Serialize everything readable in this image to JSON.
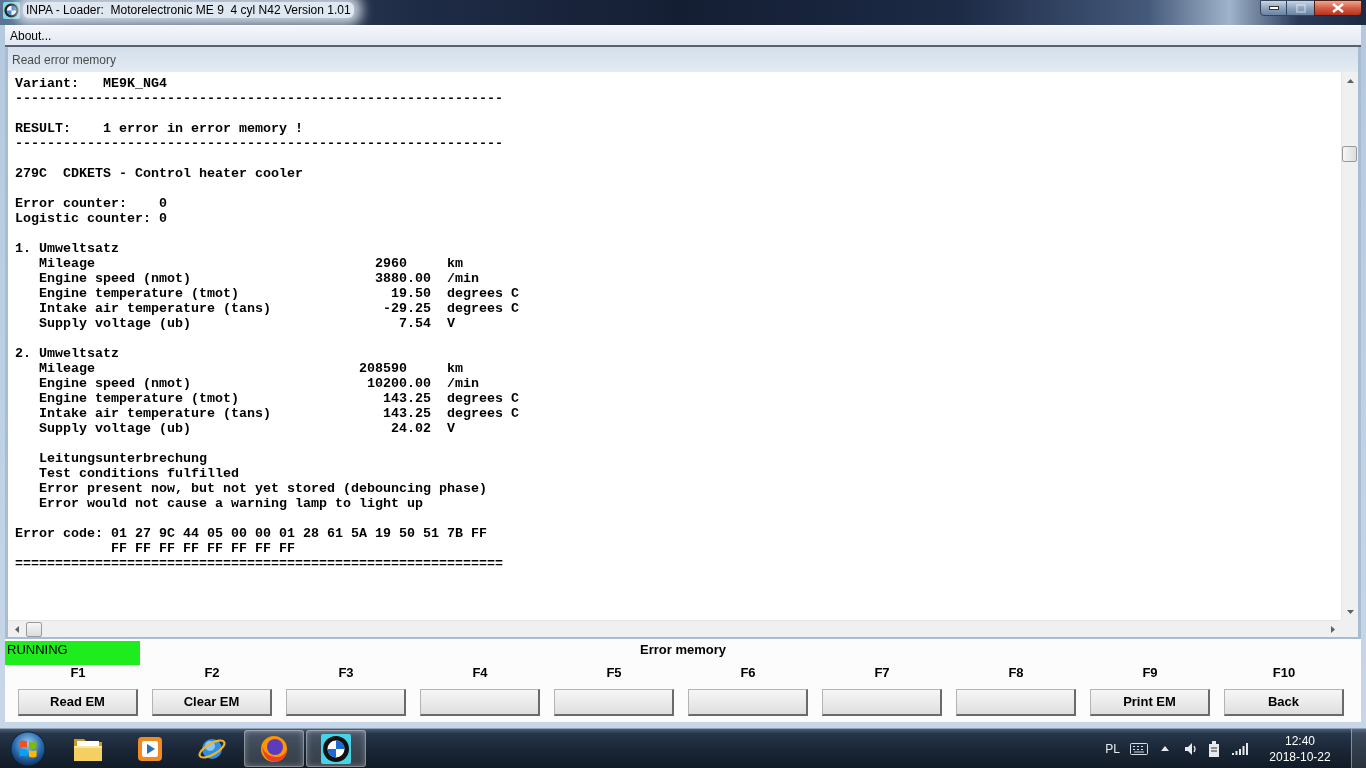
{
  "window": {
    "title": "INPA - Loader:  Motorelectronic ME 9  4 cyl N42 Version 1.01",
    "maximize_disabled": true
  },
  "menu": [
    {
      "label": "About..."
    }
  ],
  "child_window": {
    "title": "Read error memory"
  },
  "report": {
    "variant": {
      "label": "Variant:",
      "value": "ME9K_NG4",
      "underline": "-------------------------------------------------------------"
    },
    "result": {
      "label": "RESULT:",
      "value": "1 error in error memory !",
      "underline": "-------------------------------------------------------------"
    },
    "faults": [
      {
        "code": "279C",
        "description": "CDKETS - Control heater cooler",
        "counters": [
          {
            "label": "Error counter:",
            "value": "0"
          },
          {
            "label": "Logistic counter:",
            "value": "0"
          }
        ],
        "environment_sets": [
          {
            "title": "1. Umweltsatz",
            "rows": [
              {
                "kind": "count",
                "label": "Mileage",
                "value": "2960",
                "unit": "km"
              },
              {
                "kind": "measure",
                "label": "Engine speed (nmot)",
                "value": "3880.00",
                "unit": "/min"
              },
              {
                "kind": "measure",
                "label": "Engine temperature (tmot)",
                "value": "19.50",
                "unit": "degrees C"
              },
              {
                "kind": "measure",
                "label": "Intake air temperature (tans)",
                "value": "-29.25",
                "unit": "degrees C"
              },
              {
                "kind": "measure",
                "label": "Supply voltage (ub)",
                "value": "7.54",
                "unit": "V"
              }
            ]
          },
          {
            "title": "2. Umweltsatz",
            "rows": [
              {
                "kind": "count",
                "label": "Mileage",
                "value": "208590",
                "unit": "km"
              },
              {
                "kind": "measure",
                "label": "Engine speed (nmot)",
                "value": "10200.00",
                "unit": "/min"
              },
              {
                "kind": "measure",
                "label": "Engine temperature (tmot)",
                "value": "143.25",
                "unit": "degrees C"
              },
              {
                "kind": "measure",
                "label": "Intake air temperature (tans)",
                "value": "143.25",
                "unit": "degrees C"
              },
              {
                "kind": "measure",
                "label": "Supply voltage (ub)",
                "value": "24.02",
                "unit": "V"
              }
            ]
          }
        ],
        "details": [
          "Leitungsunterbrechung",
          "Test conditions fulfilled",
          "Error present now, but not yet stored (debouncing phase)",
          "Error would not cause a warning lamp to light up"
        ],
        "error_code": {
          "label": "Error code:",
          "lines": [
            "01 27 9C 44 05 00 00 01 28 61 5A 19 50 51 7B FF",
            "FF FF FF FF FF FF FF FF"
          ]
        }
      }
    ],
    "end_rule": "============================================================="
  },
  "status": "RUNNING",
  "screen_title": "Error memory",
  "function_keys": [
    {
      "key": "F1",
      "label": "Read EM"
    },
    {
      "key": "F2",
      "label": "Clear EM"
    },
    {
      "key": "F3"
    },
    {
      "key": "F4"
    },
    {
      "key": "F5"
    },
    {
      "key": "F6"
    },
    {
      "key": "F7"
    },
    {
      "key": "F8"
    },
    {
      "key": "F9",
      "label": "Print EM"
    },
    {
      "key": "F10",
      "label": "Back"
    }
  ],
  "taskbar": {
    "items": [
      {
        "open": false
      },
      {
        "open": false
      },
      {
        "open": false
      },
      {
        "open": true
      },
      {
        "open": true
      }
    ],
    "language": "PL",
    "time": "12:40",
    "date": "2018-10-22"
  }
}
